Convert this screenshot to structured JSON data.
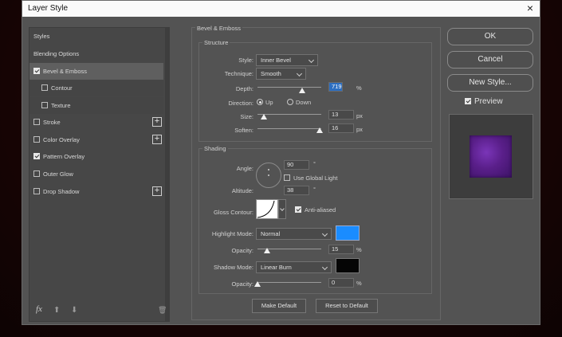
{
  "window": {
    "title": "Layer Style",
    "close_glyph": "×"
  },
  "sidebar": {
    "items": [
      {
        "label": "Styles",
        "checkbox": null,
        "plus": false
      },
      {
        "label": "Blending Options",
        "checkbox": null,
        "plus": false
      },
      {
        "label": "Bevel & Emboss",
        "checkbox": true,
        "plus": false
      },
      {
        "label": "Contour",
        "checkbox": false,
        "plus": false
      },
      {
        "label": "Texture",
        "checkbox": false,
        "plus": false
      },
      {
        "label": "Stroke",
        "checkbox": false,
        "plus": true
      },
      {
        "label": "Color Overlay",
        "checkbox": false,
        "plus": true
      },
      {
        "label": "Pattern Overlay",
        "checkbox": true,
        "plus": false
      },
      {
        "label": "Outer Glow",
        "checkbox": false,
        "plus": false
      },
      {
        "label": "Drop Shadow",
        "checkbox": false,
        "plus": true
      }
    ],
    "tools": {
      "fx": "fx",
      "up": "⬆",
      "down": "⬇",
      "trash": "🗑"
    }
  },
  "panel": {
    "title": "Bevel & Emboss",
    "structure": {
      "title": "Structure",
      "style_label": "Style:",
      "style_value": "Inner Bevel",
      "technique_label": "Technique:",
      "technique_value": "Smooth",
      "depth_label": "Depth:",
      "depth_value": "719",
      "depth_unit": "%",
      "direction_label": "Direction:",
      "dir_up": "Up",
      "dir_down": "Down",
      "size_label": "Size:",
      "size_value": "13",
      "size_unit": "px",
      "soften_label": "Soften:",
      "soften_value": "16",
      "soften_unit": "px"
    },
    "shading": {
      "title": "Shading",
      "angle_label": "Angle:",
      "angle_value": "90",
      "angle_unit": "°",
      "global_light_label": "Use Global Light",
      "altitude_label": "Altitude:",
      "altitude_value": "38",
      "altitude_unit": "°",
      "gloss_label": "Gloss Contour:",
      "anti_aliased_label": "Anti-aliased",
      "highlight_mode_label": "Highlight Mode:",
      "highlight_mode_value": "Normal",
      "highlight_opacity_label": "Opacity:",
      "highlight_opacity_value": "15",
      "highlight_opacity_unit": "%",
      "shadow_mode_label": "Shadow Mode:",
      "shadow_mode_value": "Linear Burn",
      "shadow_opacity_label": "Opacity:",
      "shadow_opacity_value": "0",
      "shadow_opacity_unit": "%"
    },
    "make_default": "Make Default",
    "reset_default": "Reset to Default"
  },
  "buttons": {
    "ok": "OK",
    "cancel": "Cancel",
    "new_style": "New Style...",
    "preview": "Preview"
  },
  "colors": {
    "highlight": "#1a8cff",
    "shadow": "#050505",
    "preview_swatch": "#5a1f8a"
  }
}
